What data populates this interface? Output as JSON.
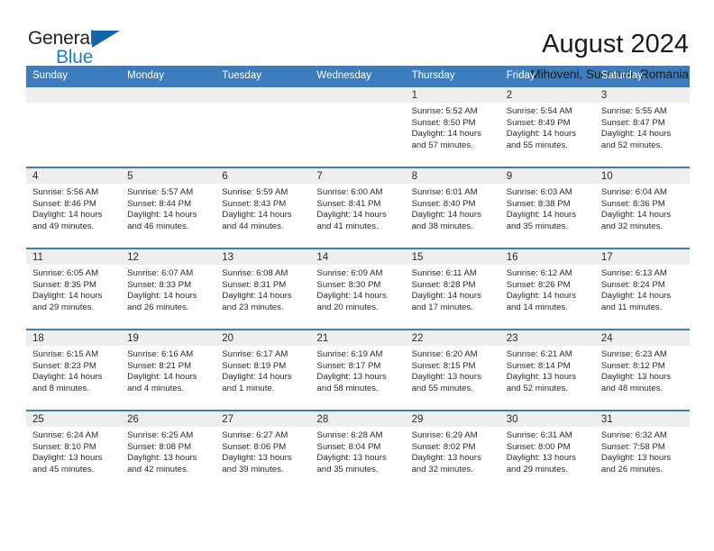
{
  "brand": {
    "name_part1": "General",
    "name_part2": "Blue",
    "triangle_color": "#1464aa",
    "blue_color": "#1a7fd4"
  },
  "header": {
    "title": "August 2024",
    "subtitle": "Mihoveni, Suceava, Romania"
  },
  "theme": {
    "header_bg": "#3c7cbf",
    "daynum_bg": "#eeeeee",
    "row_rule": "#3c7cbf"
  },
  "weekday_headers": [
    "Sunday",
    "Monday",
    "Tuesday",
    "Wednesday",
    "Thursday",
    "Friday",
    "Saturday"
  ],
  "weeks": [
    [
      {
        "day": "",
        "sunrise": "",
        "sunset": "",
        "daylight1": "",
        "daylight2": ""
      },
      {
        "day": "",
        "sunrise": "",
        "sunset": "",
        "daylight1": "",
        "daylight2": ""
      },
      {
        "day": "",
        "sunrise": "",
        "sunset": "",
        "daylight1": "",
        "daylight2": ""
      },
      {
        "day": "",
        "sunrise": "",
        "sunset": "",
        "daylight1": "",
        "daylight2": ""
      },
      {
        "day": "1",
        "sunrise": "Sunrise: 5:52 AM",
        "sunset": "Sunset: 8:50 PM",
        "daylight1": "Daylight: 14 hours",
        "daylight2": "and 57 minutes."
      },
      {
        "day": "2",
        "sunrise": "Sunrise: 5:54 AM",
        "sunset": "Sunset: 8:49 PM",
        "daylight1": "Daylight: 14 hours",
        "daylight2": "and 55 minutes."
      },
      {
        "day": "3",
        "sunrise": "Sunrise: 5:55 AM",
        "sunset": "Sunset: 8:47 PM",
        "daylight1": "Daylight: 14 hours",
        "daylight2": "and 52 minutes."
      }
    ],
    [
      {
        "day": "4",
        "sunrise": "Sunrise: 5:56 AM",
        "sunset": "Sunset: 8:46 PM",
        "daylight1": "Daylight: 14 hours",
        "daylight2": "and 49 minutes."
      },
      {
        "day": "5",
        "sunrise": "Sunrise: 5:57 AM",
        "sunset": "Sunset: 8:44 PM",
        "daylight1": "Daylight: 14 hours",
        "daylight2": "and 46 minutes."
      },
      {
        "day": "6",
        "sunrise": "Sunrise: 5:59 AM",
        "sunset": "Sunset: 8:43 PM",
        "daylight1": "Daylight: 14 hours",
        "daylight2": "and 44 minutes."
      },
      {
        "day": "7",
        "sunrise": "Sunrise: 6:00 AM",
        "sunset": "Sunset: 8:41 PM",
        "daylight1": "Daylight: 14 hours",
        "daylight2": "and 41 minutes."
      },
      {
        "day": "8",
        "sunrise": "Sunrise: 6:01 AM",
        "sunset": "Sunset: 8:40 PM",
        "daylight1": "Daylight: 14 hours",
        "daylight2": "and 38 minutes."
      },
      {
        "day": "9",
        "sunrise": "Sunrise: 6:03 AM",
        "sunset": "Sunset: 8:38 PM",
        "daylight1": "Daylight: 14 hours",
        "daylight2": "and 35 minutes."
      },
      {
        "day": "10",
        "sunrise": "Sunrise: 6:04 AM",
        "sunset": "Sunset: 8:36 PM",
        "daylight1": "Daylight: 14 hours",
        "daylight2": "and 32 minutes."
      }
    ],
    [
      {
        "day": "11",
        "sunrise": "Sunrise: 6:05 AM",
        "sunset": "Sunset: 8:35 PM",
        "daylight1": "Daylight: 14 hours",
        "daylight2": "and 29 minutes."
      },
      {
        "day": "12",
        "sunrise": "Sunrise: 6:07 AM",
        "sunset": "Sunset: 8:33 PM",
        "daylight1": "Daylight: 14 hours",
        "daylight2": "and 26 minutes."
      },
      {
        "day": "13",
        "sunrise": "Sunrise: 6:08 AM",
        "sunset": "Sunset: 8:31 PM",
        "daylight1": "Daylight: 14 hours",
        "daylight2": "and 23 minutes."
      },
      {
        "day": "14",
        "sunrise": "Sunrise: 6:09 AM",
        "sunset": "Sunset: 8:30 PM",
        "daylight1": "Daylight: 14 hours",
        "daylight2": "and 20 minutes."
      },
      {
        "day": "15",
        "sunrise": "Sunrise: 6:11 AM",
        "sunset": "Sunset: 8:28 PM",
        "daylight1": "Daylight: 14 hours",
        "daylight2": "and 17 minutes."
      },
      {
        "day": "16",
        "sunrise": "Sunrise: 6:12 AM",
        "sunset": "Sunset: 8:26 PM",
        "daylight1": "Daylight: 14 hours",
        "daylight2": "and 14 minutes."
      },
      {
        "day": "17",
        "sunrise": "Sunrise: 6:13 AM",
        "sunset": "Sunset: 8:24 PM",
        "daylight1": "Daylight: 14 hours",
        "daylight2": "and 11 minutes."
      }
    ],
    [
      {
        "day": "18",
        "sunrise": "Sunrise: 6:15 AM",
        "sunset": "Sunset: 8:23 PM",
        "daylight1": "Daylight: 14 hours",
        "daylight2": "and 8 minutes."
      },
      {
        "day": "19",
        "sunrise": "Sunrise: 6:16 AM",
        "sunset": "Sunset: 8:21 PM",
        "daylight1": "Daylight: 14 hours",
        "daylight2": "and 4 minutes."
      },
      {
        "day": "20",
        "sunrise": "Sunrise: 6:17 AM",
        "sunset": "Sunset: 8:19 PM",
        "daylight1": "Daylight: 14 hours",
        "daylight2": "and 1 minute."
      },
      {
        "day": "21",
        "sunrise": "Sunrise: 6:19 AM",
        "sunset": "Sunset: 8:17 PM",
        "daylight1": "Daylight: 13 hours",
        "daylight2": "and 58 minutes."
      },
      {
        "day": "22",
        "sunrise": "Sunrise: 6:20 AM",
        "sunset": "Sunset: 8:15 PM",
        "daylight1": "Daylight: 13 hours",
        "daylight2": "and 55 minutes."
      },
      {
        "day": "23",
        "sunrise": "Sunrise: 6:21 AM",
        "sunset": "Sunset: 8:14 PM",
        "daylight1": "Daylight: 13 hours",
        "daylight2": "and 52 minutes."
      },
      {
        "day": "24",
        "sunrise": "Sunrise: 6:23 AM",
        "sunset": "Sunset: 8:12 PM",
        "daylight1": "Daylight: 13 hours",
        "daylight2": "and 48 minutes."
      }
    ],
    [
      {
        "day": "25",
        "sunrise": "Sunrise: 6:24 AM",
        "sunset": "Sunset: 8:10 PM",
        "daylight1": "Daylight: 13 hours",
        "daylight2": "and 45 minutes."
      },
      {
        "day": "26",
        "sunrise": "Sunrise: 6:25 AM",
        "sunset": "Sunset: 8:08 PM",
        "daylight1": "Daylight: 13 hours",
        "daylight2": "and 42 minutes."
      },
      {
        "day": "27",
        "sunrise": "Sunrise: 6:27 AM",
        "sunset": "Sunset: 8:06 PM",
        "daylight1": "Daylight: 13 hours",
        "daylight2": "and 39 minutes."
      },
      {
        "day": "28",
        "sunrise": "Sunrise: 6:28 AM",
        "sunset": "Sunset: 8:04 PM",
        "daylight1": "Daylight: 13 hours",
        "daylight2": "and 35 minutes."
      },
      {
        "day": "29",
        "sunrise": "Sunrise: 6:29 AM",
        "sunset": "Sunset: 8:02 PM",
        "daylight1": "Daylight: 13 hours",
        "daylight2": "and 32 minutes."
      },
      {
        "day": "30",
        "sunrise": "Sunrise: 6:31 AM",
        "sunset": "Sunset: 8:00 PM",
        "daylight1": "Daylight: 13 hours",
        "daylight2": "and 29 minutes."
      },
      {
        "day": "31",
        "sunrise": "Sunrise: 6:32 AM",
        "sunset": "Sunset: 7:58 PM",
        "daylight1": "Daylight: 13 hours",
        "daylight2": "and 26 minutes."
      }
    ]
  ]
}
